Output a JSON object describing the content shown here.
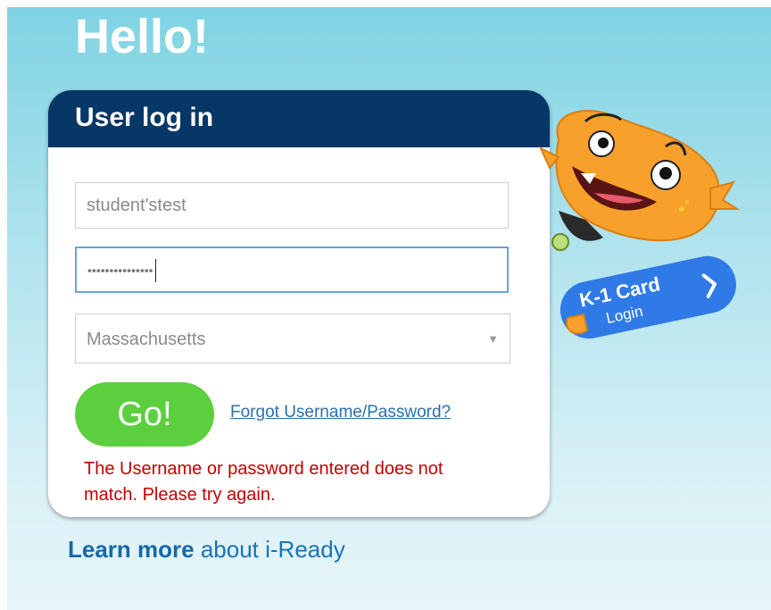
{
  "header": {
    "greeting": "Hello!"
  },
  "login_card": {
    "title": "User log in",
    "username_value": "student'stest",
    "password_mask": "•••••••••••••••",
    "state_selected": "Massachusetts",
    "go_label": "Go!",
    "forgot_label": "Forgot Username/Password?",
    "error_message": "The Username or password entered does not match. Please try again."
  },
  "k1_card": {
    "title": "K-1 Card",
    "subtitle": "Login"
  },
  "footer": {
    "learn_more_bold": "Learn more",
    "learn_more_rest": " about i-Ready"
  },
  "colors": {
    "header_navy": "#063767",
    "go_green": "#5ccf3e",
    "error_red": "#c40000",
    "k1_blue": "#2f7ae6",
    "monster_orange": "#f7a12c"
  },
  "icons": {
    "select_arrow": "chevron-down-icon",
    "k1_arrow": "chevron-right-icon"
  }
}
